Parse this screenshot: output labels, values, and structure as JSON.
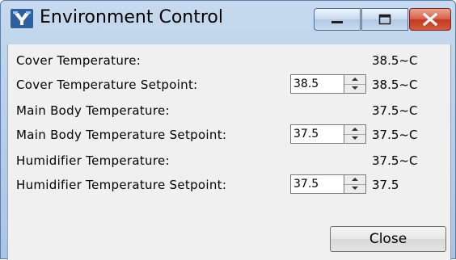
{
  "window": {
    "title": "Environment Control",
    "icon": "app-icon",
    "controls": {
      "minimize": "minimize-icon",
      "maximize": "maximize-icon",
      "close": "close-icon"
    },
    "close_color": "#d24a2e"
  },
  "rows": [
    {
      "label": "Cover Temperature:",
      "value": "38.5~C"
    },
    {
      "label": "Cover Temperature Setpoint:",
      "setpoint": "38.5",
      "value": "38.5~C"
    },
    {
      "label": "Main Body Temperature:",
      "value": "37.5~C"
    },
    {
      "label": "Main Body Temperature Setpoint:",
      "setpoint": "37.5",
      "value": "37.5~C"
    },
    {
      "label": "Humidifier Temperature:",
      "value": "37.5~C"
    },
    {
      "label": "Humidifier Temperature Setpoint:",
      "setpoint": "37.5",
      "value": "37.5"
    }
  ],
  "buttons": {
    "close_label": "Close"
  }
}
